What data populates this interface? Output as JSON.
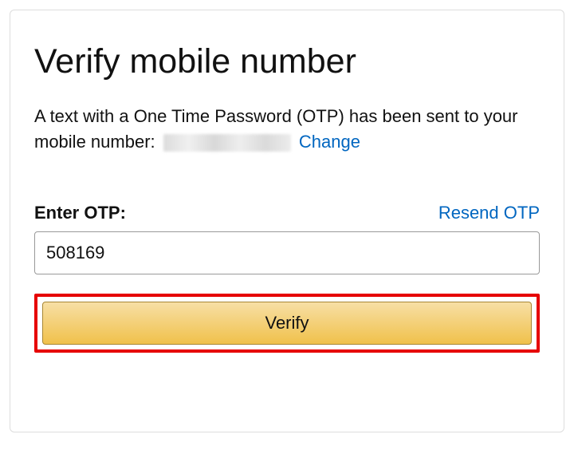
{
  "title": "Verify mobile number",
  "description": {
    "prefix": "A text with a One Time Password (OTP) has been sent to your mobile number: ",
    "masked_number": "",
    "change_link": "Change"
  },
  "otp": {
    "label": "Enter OTP:",
    "resend_label": "Resend OTP",
    "value": "508169"
  },
  "verify_label": "Verify",
  "colors": {
    "link": "#0066c0",
    "button_border": "#a88734",
    "highlight_border": "#e60000"
  }
}
